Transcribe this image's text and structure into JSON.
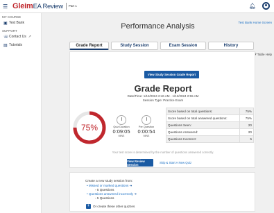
{
  "topbar": {
    "brand": "Gleim",
    "brand_sub": "EA Review",
    "part": "Part 1"
  },
  "sidebar": {
    "section1": "MY COURSE",
    "test_bank": "Test Bank",
    "section2": "SUPPORT",
    "contact": "Contact Us",
    "tutorials": "Tutorials"
  },
  "main": {
    "title": "Performance Analysis",
    "home_link": "Test Bank Home Screen",
    "table_help": "Table Help",
    "tabs": [
      {
        "label": "Grade Report",
        "active": true
      },
      {
        "label": "Study Session",
        "active": false
      },
      {
        "label": "Exam Session",
        "active": false
      },
      {
        "label": "History",
        "active": false
      }
    ]
  },
  "report": {
    "view_btn": "View Study Session Grade Report",
    "title": "Grade Report",
    "datetime": "Date/Time: 1/12/2024 2:46 AM - 1/12/2024 2:55 AM",
    "session_type": "Session Type: Practice Exam",
    "score_pct": "75%",
    "score_fraction": 0.75,
    "quiz_duration_label": "Quiz Duration",
    "quiz_duration": "0:09:05",
    "per_question_label": "Per Question",
    "per_question": "0:00:54",
    "time_unit": "MINS",
    "stats": [
      {
        "label": "Score based on total questions:",
        "value": "75%"
      },
      {
        "label": "Score based on total answered questions:",
        "value": "75%"
      },
      {
        "label": "Questions Seen:",
        "value": "20"
      },
      {
        "label": "Questions Answered:",
        "value": "20"
      },
      {
        "label": "Questions Incorrect:",
        "value": "5"
      }
    ],
    "note": "Your test score is determined by the number of questions answered correctly.",
    "review_btn": "View Review Session",
    "skip_link": "Skip & Start A New Quiz"
  },
  "new_session": {
    "heading": "Create a new study session from:",
    "missed": "Missed or marked questions",
    "missed_count": "5 Questions",
    "incorrect": "Questions answered incorrectly",
    "incorrect_count": "5 Questions",
    "other": "Or create these other quizzes"
  },
  "colors": {
    "brand_red": "#c0272d",
    "navy": "#1a3d6d",
    "primary_button": "#1a5aa3"
  }
}
